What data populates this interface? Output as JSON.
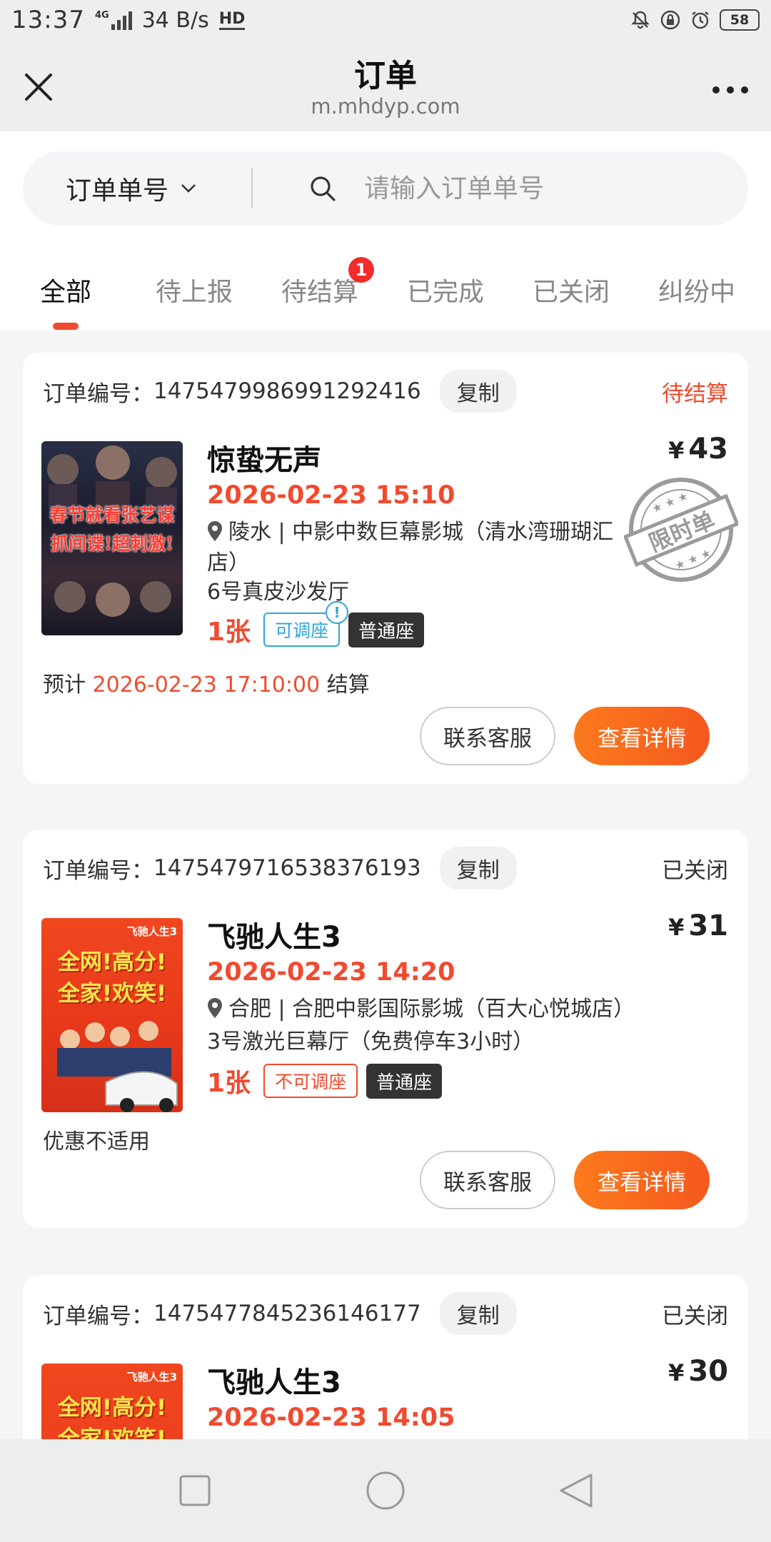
{
  "status_bar": {
    "time": "13:37",
    "network": "4G",
    "speed": "34 B/s",
    "hd": "HD",
    "battery": "58",
    "icons": [
      "mute-bell-icon",
      "lock-rotation-icon",
      "alarm-icon"
    ]
  },
  "nav": {
    "title": "订单",
    "subtitle": "m.mhdyp.com",
    "close_icon": "close-icon",
    "more_icon": "more-dots-icon"
  },
  "search": {
    "type_label": "订单单号",
    "placeholder": "请输入订单单号"
  },
  "tabs": [
    {
      "label": "全部",
      "active": true
    },
    {
      "label": "待上报"
    },
    {
      "label": "待结算",
      "badge": "1"
    },
    {
      "label": "已完成"
    },
    {
      "label": "已关闭"
    },
    {
      "label": "纠纷中"
    }
  ],
  "orders": [
    {
      "order_label": "订单编号：",
      "order_no": "1475479986991292416",
      "copy": "复制",
      "status": "待结算",
      "status_color": "#f04a2f",
      "movie": "惊蛰无声",
      "price_symbol": "¥",
      "price": "43",
      "showtime": "2026-02-23 15:10",
      "location": "陵水 | 中影中数巨幕影城（清水湾珊瑚汇店）",
      "hall": "6号真皮沙发厅",
      "count": "1张",
      "adjust_tag": "可调座",
      "adjust_tip": "!",
      "seat_tag": "普通座",
      "note_prefix": "预计 ",
      "note_time": "2026-02-23 17:10:00",
      "note_suffix": " 结算",
      "stamp_text": "限时单",
      "poster_text": [
        "春节就看张艺谋",
        "抓间谍!超刺激!"
      ],
      "contact": "联系客服",
      "detail": "查看详情"
    },
    {
      "order_label": "订单编号：",
      "order_no": "1475479716538376193",
      "copy": "复制",
      "status": "已关闭",
      "status_color": "#333333",
      "movie": "飞驰人生3",
      "price_symbol": "¥",
      "price": "31",
      "showtime": "2026-02-23 14:20",
      "location": "合肥 | 合肥中影国际影城（百大心悦城店）",
      "hall": "3号激光巨幕厅（免费停车3小时）",
      "count": "1张",
      "adjust_tag": "不可调座",
      "seat_tag": "普通座",
      "note": "优惠不适用",
      "poster_text": [
        "全网!高分!",
        "全家!欢笑!"
      ],
      "contact": "联系客服",
      "detail": "查看详情"
    },
    {
      "order_label": "订单编号：",
      "order_no": "1475477845236146177",
      "copy": "复制",
      "status": "已关闭",
      "status_color": "#333333",
      "movie": "飞驰人生3",
      "price_symbol": "¥",
      "price": "30",
      "showtime": "2026-02-23 14:05",
      "poster_text": [
        "全网!高分!",
        "全家!欢笑!"
      ]
    }
  ],
  "system_nav": [
    "recent-apps-square-icon",
    "home-circle-icon",
    "back-triangle-icon"
  ]
}
